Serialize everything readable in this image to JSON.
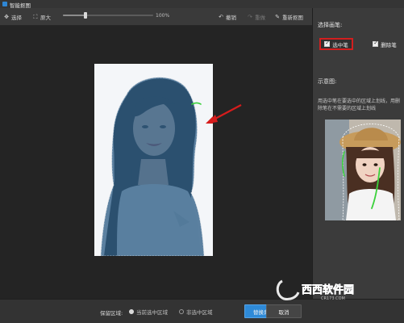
{
  "window": {
    "title": "智能抠图"
  },
  "toolbar": {
    "tools": [
      {
        "name": "select",
        "label": "选择",
        "icon": "move-icon"
      },
      {
        "name": "zoom-fit",
        "label": "原大",
        "icon": "fit-icon"
      }
    ],
    "zoom": {
      "value_label": "100%",
      "level": 0.25
    },
    "undo_label": "撤销",
    "redo_label": "重做",
    "redraw_label": "重新抠图"
  },
  "panel": {
    "brush_heading": "选择画笔:",
    "brushes": [
      {
        "label": "选中笔",
        "selected": true
      },
      {
        "label": "删除笔",
        "selected": false
      }
    ],
    "example_heading": "示意图:",
    "hint": "用选中笔在要选中的区域上划线，用删除笔在不需要的区域上划线"
  },
  "footer": {
    "keep_label": "保留区域:",
    "options": [
      {
        "label": "当前选中区域",
        "selected": true
      },
      {
        "label": "非选中区域",
        "selected": false
      }
    ],
    "replace_label": "替换背景",
    "cancel_label": "取消"
  },
  "watermark": {
    "text": "西西软件园",
    "subtext": "CR173.COM"
  },
  "colors": {
    "accent": "#2e8ad8",
    "highlight_border": "#d21f1f",
    "selection_overlay": "#2f5f86",
    "marker_arrow": "#d61c1c",
    "brush_stroke": "#3ad13a"
  }
}
